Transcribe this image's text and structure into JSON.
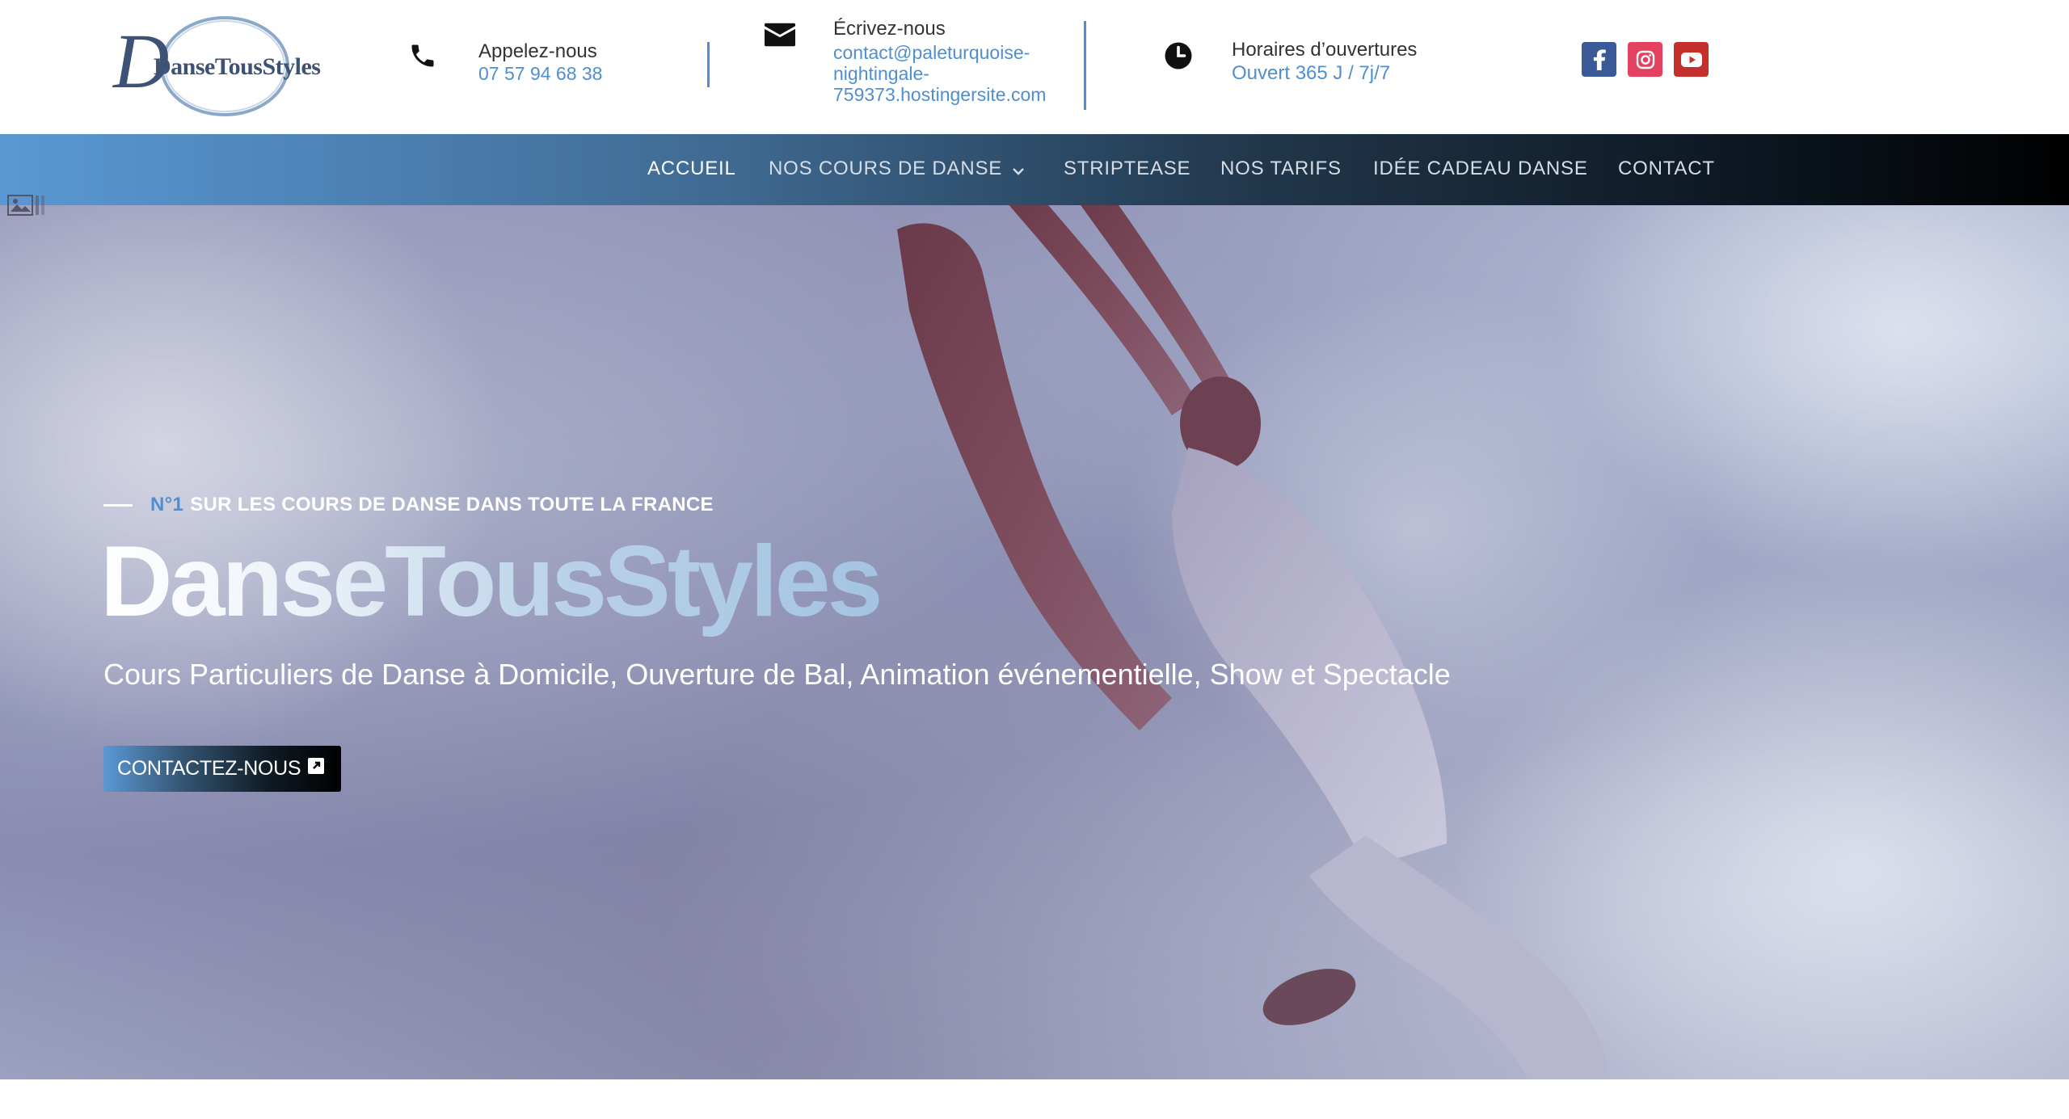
{
  "header": {
    "logo_text": "DanseTousStyles",
    "phone": {
      "title": "Appelez-nous",
      "value": "07 57 94 68 38",
      "icon": "phone-icon"
    },
    "email": {
      "title": "Écrivez-nous",
      "value_lines": [
        "contact@paleturquoise-",
        "nightingale-",
        "759373.hostingersite.com"
      ],
      "icon": "envelope-icon"
    },
    "hours": {
      "title": "Horaires d’ouvertures",
      "value": "Ouvert 365 J / 7j/7",
      "icon": "clock-icon"
    },
    "social": [
      {
        "name": "facebook",
        "icon": "facebook-icon",
        "color": "#3b5998"
      },
      {
        "name": "instagram",
        "icon": "instagram-icon",
        "color": "#e4405f"
      },
      {
        "name": "youtube",
        "icon": "youtube-icon",
        "color": "#c4302b"
      }
    ]
  },
  "nav": {
    "items": [
      {
        "label": "ACCUEIL",
        "active": true
      },
      {
        "label": "NOS COURS DE DANSE",
        "has_dropdown": true
      },
      {
        "label": "STRIPTEASE"
      },
      {
        "label": "NOS TARIFS"
      },
      {
        "label": "IDÉE CADEAU DANSE"
      },
      {
        "label": "CONTACT"
      }
    ]
  },
  "hero": {
    "kicker_number": "N°1",
    "kicker_text": "SUR LES COURS DE DANSE DANS TOUTE LA FRANCE",
    "title": "DanseTousStyles",
    "subtitle": "Cours Particuliers de Danse à Domicile, Ouverture de Bal, Animation événementielle, Show et Spectacle",
    "cta_label": "CONTACTEZ-NOUS",
    "cta_icon": "external-link-icon"
  },
  "colors": {
    "accent": "#4f8fd0",
    "text_dark": "#333333",
    "logo": "#3d5274"
  }
}
